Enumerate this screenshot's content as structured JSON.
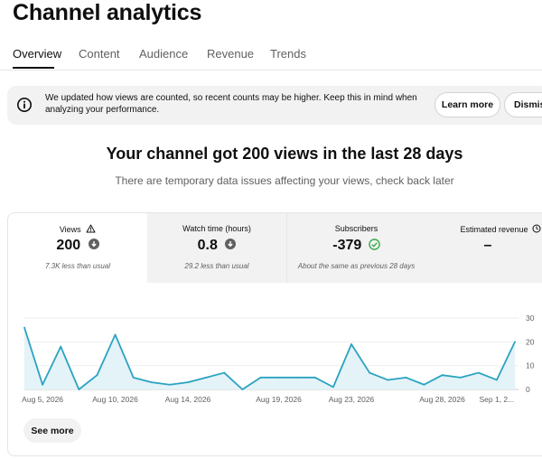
{
  "page": {
    "title": "Channel analytics"
  },
  "tabs": [
    {
      "label": "Overview"
    },
    {
      "label": "Content"
    },
    {
      "label": "Audience"
    },
    {
      "label": "Revenue"
    },
    {
      "label": "Trends"
    }
  ],
  "banner": {
    "line1": "We updated how views are counted, so recent counts may be higher. Keep this in mind when",
    "line2": "analyzing your performance.",
    "learn_more": "Learn more",
    "dismiss": "Dismis"
  },
  "summary": {
    "headline": "Your channel got 200 views in the last 28 days",
    "subhead": "There are temporary data issues affecting your views, check back later"
  },
  "metrics": [
    {
      "label": "Views",
      "value": "200",
      "note": "7.3K less than usual"
    },
    {
      "label": "Watch time (hours)",
      "value": "0.8",
      "note": "29.2 less than usual"
    },
    {
      "label": "Subscribers",
      "value": "-379",
      "note": "About the same as previous 28 days"
    },
    {
      "label": "Estimated revenue",
      "value": "–",
      "note": ""
    }
  ],
  "colors": {
    "line": "#2aa3c1",
    "area": "#e3f3f8",
    "accent": "#0f0f0f",
    "check": "#2ba640"
  },
  "chart_data": {
    "type": "area",
    "x_tick_labels": [
      "Aug 5, 2026",
      "Aug 10, 2026",
      "Aug 14, 2026",
      "Aug 19, 2026",
      "Aug 23, 2026",
      "Aug 28, 2026",
      "Sep 1, 2..."
    ],
    "y_tick_labels": [
      "30",
      "20",
      "10",
      "0"
    ],
    "ylim": [
      0,
      30
    ],
    "x_ticks_index": [
      1,
      5,
      9,
      14,
      18,
      23,
      26
    ],
    "values": [
      26,
      2,
      18,
      0,
      6,
      23,
      5,
      3,
      2,
      3,
      5,
      7,
      0,
      5,
      5,
      5,
      5,
      1,
      19,
      7,
      4,
      5,
      2,
      6,
      5,
      7,
      4,
      20
    ],
    "grid": true
  },
  "see_more": "See more"
}
